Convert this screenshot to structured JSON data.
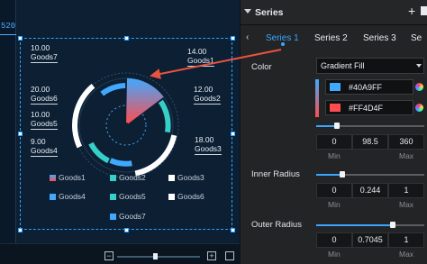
{
  "ruler": {
    "label": "520"
  },
  "chart_data": {
    "type": "pie",
    "categories": [
      "Goods1",
      "Goods2",
      "Goods3",
      "Goods4",
      "Goods5",
      "Goods6",
      "Goods7"
    ],
    "values": [
      14.0,
      12.0,
      18.0,
      9.0,
      10.0,
      20.0,
      10.0
    ],
    "series": [
      {
        "values": [
          14.0,
          12.0,
          18.0,
          9.0,
          10.0,
          20.0,
          10.0
        ]
      }
    ],
    "title": "",
    "data_labels": [
      {
        "value": "14.00",
        "name": "Goods1"
      },
      {
        "value": "12.00",
        "name": "Goods2"
      },
      {
        "value": "18.00",
        "name": "Goods3"
      },
      {
        "value": "9.00",
        "name": "Goods4"
      },
      {
        "value": "10.00",
        "name": "Goods5"
      },
      {
        "value": "20.00",
        "name": "Goods6"
      },
      {
        "value": "10.00",
        "name": "Goods7"
      }
    ],
    "legend": [
      "Goods1",
      "Goods2",
      "Goods3",
      "Goods4",
      "Goods5",
      "Goods6",
      "Goods7"
    ],
    "legend_placement": "bottom",
    "colors": [
      "gradient #40A9FF→#FF4D4F",
      "#36cfc9",
      "#ffffff",
      "#40a9ff",
      "#36cfc9",
      "#ffffff",
      "#40a9ff"
    ],
    "inner_radius": 0.244,
    "outer_radius": 0.7045
  },
  "colors": {
    "accent": "#3aa6ff",
    "goods1_start": "#40A9FF",
    "goods1_end": "#FF4D4F",
    "teal": "#36cfc9",
    "white": "#ffffff",
    "blue": "#40a9ff",
    "arrow": "#e8533f"
  },
  "panel": {
    "title": "Series",
    "tabs": [
      "Series 1",
      "Series 2",
      "Series 3",
      "Se"
    ],
    "active_tab": "Series 1",
    "color": {
      "label": "Color",
      "fill_type": "Gradient Fill",
      "stop1": "#40A9FF",
      "stop2": "#FF4D4F",
      "angle_slider": 0.19,
      "min": "0",
      "value": "98.5",
      "max": "360",
      "min_caption": "Min",
      "max_caption": "Max"
    },
    "inner_radius": {
      "label": "Inner Radius",
      "slider": 0.244,
      "min": "0",
      "value": "0.244",
      "max": "1",
      "min_caption": "Min",
      "max_caption": "Max"
    },
    "outer_radius": {
      "label": "Outer Radius",
      "slider": 0.7045,
      "min": "0",
      "value": "0.7045",
      "max": "1",
      "min_caption": "Min",
      "max_caption": "Max"
    }
  }
}
